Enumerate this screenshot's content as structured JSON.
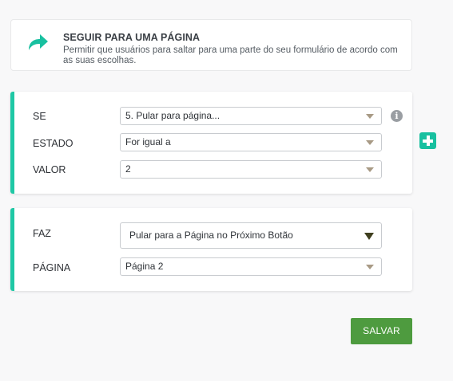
{
  "header": {
    "title": "SEGUIR PARA UMA PÁGINA",
    "description": "Permitir que usuários para saltar para uma parte do seu formulário de acordo com as suas escolhas.",
    "icon": "share-arrow-icon"
  },
  "condition": {
    "if_label": "SE",
    "if_value": "5. Pular para página...",
    "state_label": "ESTADO",
    "state_value": "For igual a",
    "value_label": "VALOR",
    "value_value": "2"
  },
  "action": {
    "do_label": "FAZ",
    "do_value": "Pular para a Página no Próximo Botão",
    "page_label": "PÁGINA",
    "page_value": "Página 2"
  },
  "save_label": "SALVAR",
  "info_glyph": "i",
  "colors": {
    "accent": "#1fc8a5",
    "save": "#4e9b3f"
  }
}
